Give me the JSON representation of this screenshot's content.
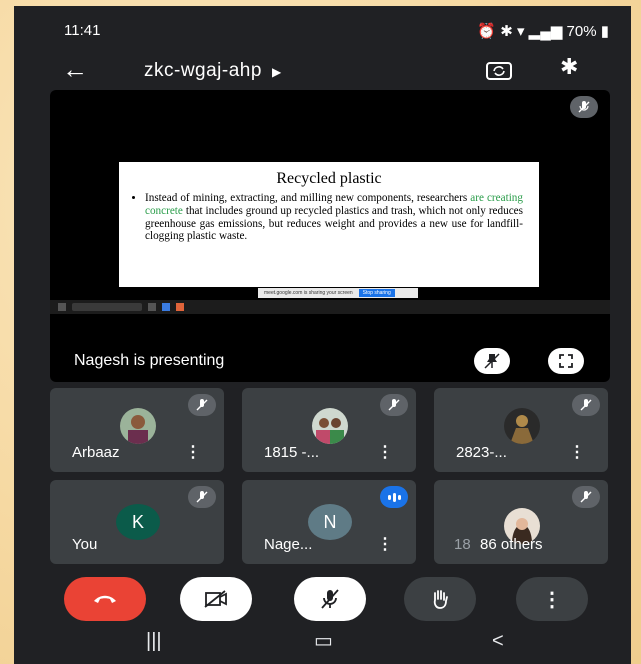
{
  "status_bar": {
    "time": "11:41",
    "right_text": "70%"
  },
  "meeting": {
    "code": "zkc-wgaj-ahp"
  },
  "presentation": {
    "slide_title": "Recycled plastic",
    "slide_text_before": "Instead of mining, extracting, and milling new components, researchers ",
    "slide_text_highlight": "are creating concrete",
    "slide_text_after": " that includes ground up recycled plastics and trash, which not only reduces greenhouse gas emissions, but reduces weight and provides a new use for landfill-clogging plastic waste.",
    "presenting_label": "Nagesh is presenting",
    "share_strip_text": "meet.google.com is sharing your screen",
    "stop_sharing_label": "Stop sharing"
  },
  "participants": [
    {
      "name": "Arbaaz"
    },
    {
      "name": "1815 -..."
    },
    {
      "name": "2823-..."
    },
    {
      "name": "You",
      "initial": "K",
      "avatar_color": "#0b5b4a"
    },
    {
      "name": "Nage...",
      "initial": "N",
      "avatar_color": "#5f7b86"
    },
    {
      "name": "86 others",
      "ghost_text": "18"
    }
  ],
  "colors": {
    "end_call": "#ea4335",
    "accent_blue": "#1a73e8",
    "tile_bg": "#3c4043"
  },
  "icons": [
    "back-arrow-icon",
    "switch-camera-icon",
    "bluetooth-icon",
    "mic-off-icon",
    "pin-off-icon",
    "fullscreen-icon",
    "more-vert-icon",
    "end-call-icon",
    "video-off-icon",
    "raise-hand-icon"
  ]
}
